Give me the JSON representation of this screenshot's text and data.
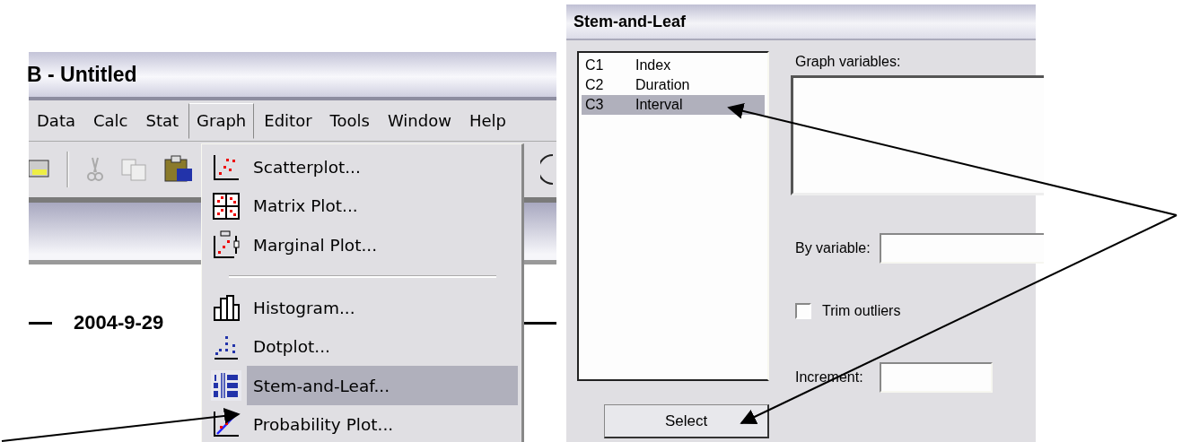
{
  "main_window": {
    "title": "B - Untitled",
    "menu": [
      {
        "label": "Data",
        "selected": false
      },
      {
        "label": "Calc",
        "selected": false
      },
      {
        "label": "Stat",
        "selected": false
      },
      {
        "label": "Graph",
        "selected": true
      },
      {
        "label": "Editor",
        "selected": false
      },
      {
        "label": "Tools",
        "selected": false
      },
      {
        "label": "Window",
        "selected": false
      },
      {
        "label": "Help",
        "selected": false
      }
    ],
    "date": "2004-9-29",
    "graph_menu": [
      {
        "kind": "item",
        "label": "Scatterplot...",
        "selected": false
      },
      {
        "kind": "item",
        "label": "Matrix Plot...",
        "selected": false
      },
      {
        "kind": "item",
        "label": "Marginal Plot...",
        "selected": false
      },
      {
        "kind": "separator"
      },
      {
        "kind": "item",
        "label": "Histogram...",
        "selected": false
      },
      {
        "kind": "item",
        "label": "Dotplot...",
        "selected": false
      },
      {
        "kind": "item",
        "label": "Stem-and-Leaf...",
        "selected": true
      },
      {
        "kind": "item",
        "label": "Probability Plot...",
        "selected": false
      }
    ]
  },
  "dialog": {
    "title": "Stem-and-Leaf",
    "columns": [
      {
        "id": "C1",
        "name": "Index",
        "selected": false
      },
      {
        "id": "C2",
        "name": "Duration",
        "selected": false
      },
      {
        "id": "C3",
        "name": "Interval",
        "selected": true
      }
    ],
    "graph_variables_label": "Graph variables:",
    "by_variable_label": "By variable:",
    "trim_outliers": {
      "label": "Trim outliers",
      "checked": false
    },
    "increment_label": "Increment:",
    "select_button": "Select"
  }
}
